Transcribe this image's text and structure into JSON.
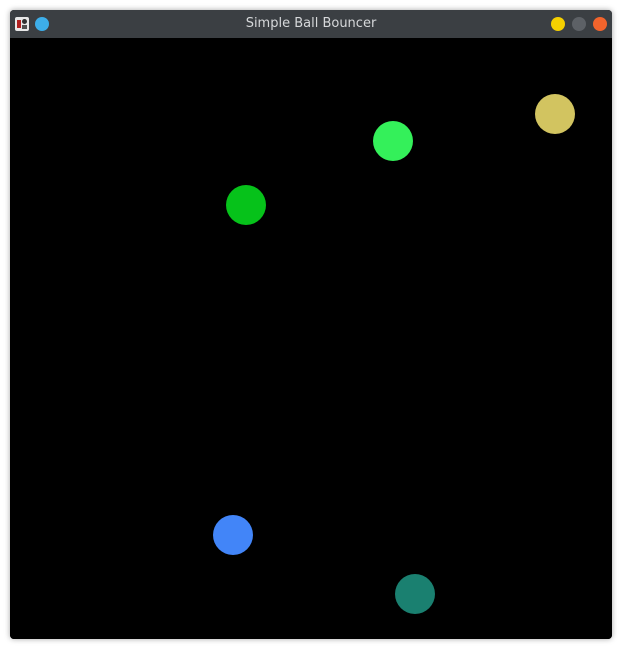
{
  "window": {
    "title": "Simple Ball Bouncer",
    "titlebar_color": "#3b3f43",
    "title_color": "#d6d8da",
    "app_icon": "java-app-icon",
    "menu_icon": "window-menu-dot-icon",
    "menu_icon_color": "#3daee9",
    "controls": {
      "minimize_color": "#f5d000",
      "maximize_color": "#5d6166",
      "close_color": "#f2642c"
    }
  },
  "canvas": {
    "background": "#000000",
    "balls": [
      {
        "color": "#d2c460"
      },
      {
        "color": "#34f05a"
      },
      {
        "color": "#06c21a"
      },
      {
        "color": "#4285f8"
      },
      {
        "color": "#1a8070"
      }
    ]
  }
}
